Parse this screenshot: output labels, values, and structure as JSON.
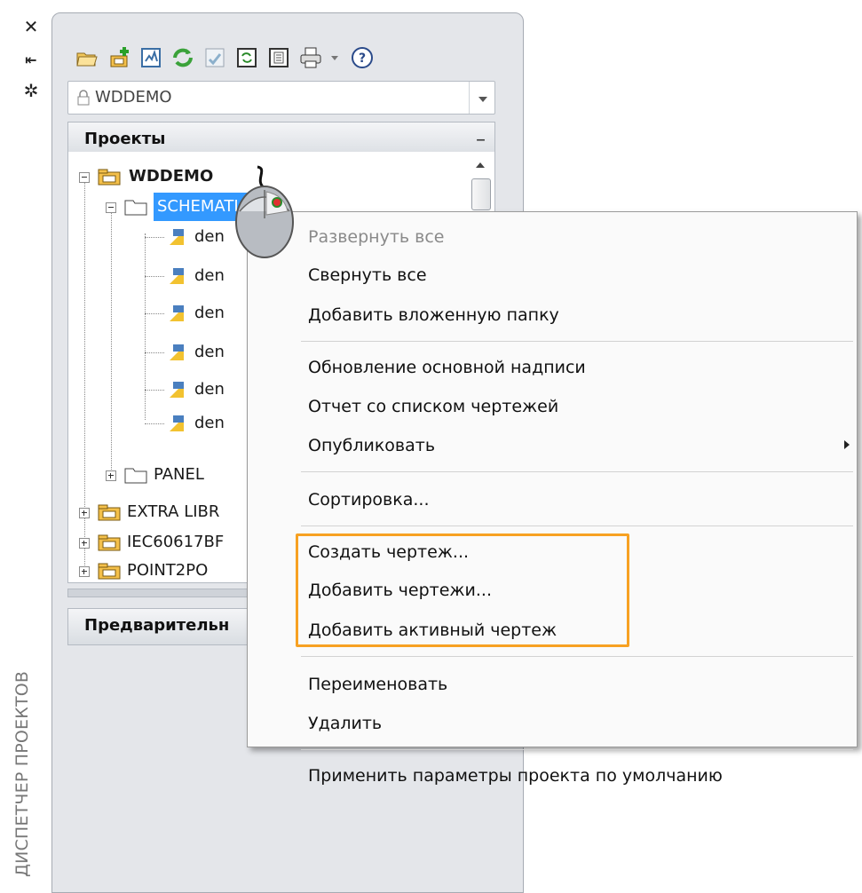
{
  "panel": {
    "vertical_title": "ДИСПЕТЧЕР ПРОЕКТОВ",
    "strip_icons": [
      "close-icon",
      "auto-hide-icon",
      "properties-icon"
    ]
  },
  "toolbar": {
    "icons": [
      "open-project-icon",
      "new-project-icon",
      "new-drawing-icon",
      "refresh-icon",
      "project-task-list-icon",
      "descriptions-icon",
      "project-settings-icon",
      "plot-icon",
      "help-icon"
    ]
  },
  "project_selector": {
    "value": "WDDEMO"
  },
  "projects_section": {
    "title": "Проекты",
    "collapse": "–",
    "tree": {
      "root": "WDDEMO",
      "folder_selected": "SCHEMATIC",
      "drawings": [
        "den",
        "den",
        "den",
        "den",
        "den",
        "den"
      ],
      "folder2": "PANEL",
      "projects": [
        "EXTRA LIBR",
        "IEC60617BF",
        "POINT2PO"
      ]
    }
  },
  "preview_section": {
    "title": "Предварительн"
  },
  "context_menu": {
    "items": [
      {
        "label": "Развернуть все",
        "disabled": true
      },
      {
        "label": "Свернуть все",
        "disabled": false
      },
      {
        "label": "Добавить вложенную папку",
        "disabled": false
      },
      {
        "label": "Обновление основной надписи",
        "disabled": false
      },
      {
        "label": "Отчет со списком чертежей",
        "disabled": false
      },
      {
        "label": "Опубликовать",
        "disabled": false,
        "submenu": true
      },
      {
        "label": "Сортировка...",
        "disabled": false
      },
      {
        "label": "Создать чертеж...",
        "disabled": false
      },
      {
        "label": "Добавить чертежи...",
        "disabled": false
      },
      {
        "label": "Добавить активный чертеж",
        "disabled": false
      },
      {
        "label": "Переименовать",
        "disabled": false
      },
      {
        "label": "Удалить",
        "disabled": false
      },
      {
        "label": "Применить параметры проекта по умолчанию",
        "disabled": false
      }
    ],
    "highlight_color": "#f7a122"
  },
  "colors": {
    "selection": "#3399ff",
    "panel_bg": "#e4e6ea"
  }
}
